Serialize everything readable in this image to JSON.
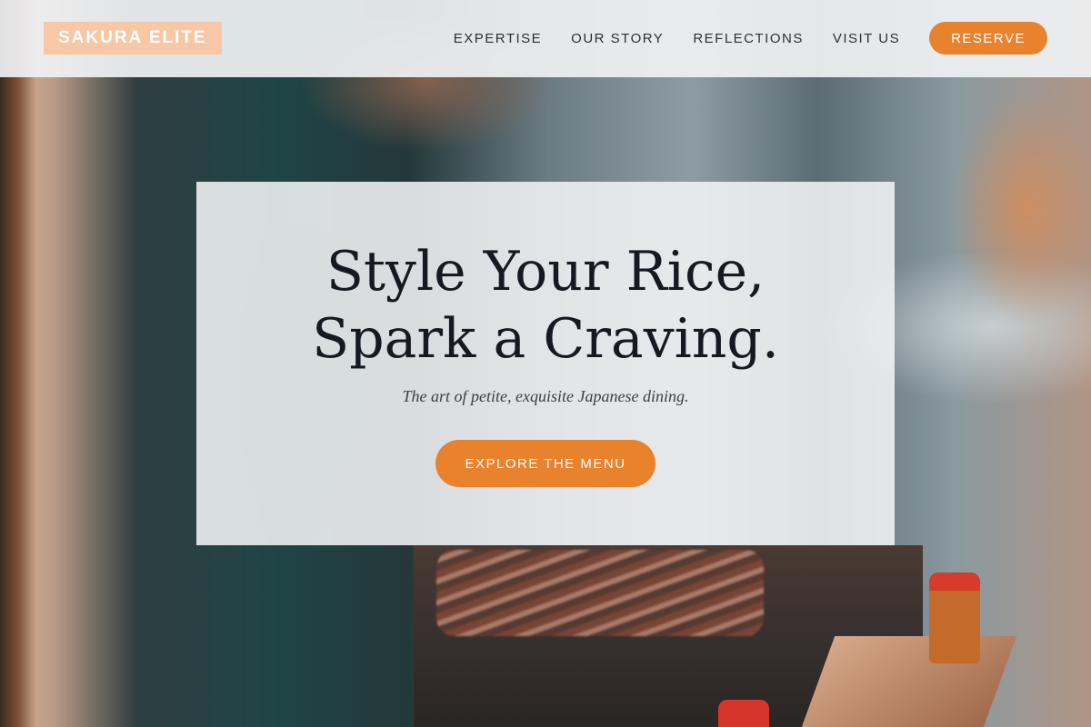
{
  "brand": {
    "logo_text": "SAKURA ELITE"
  },
  "nav": {
    "items": [
      {
        "label": "EXPERTISE"
      },
      {
        "label": "OUR STORY"
      },
      {
        "label": "REFLECTIONS"
      },
      {
        "label": "VISIT US"
      }
    ],
    "cta_label": "RESERVE"
  },
  "hero": {
    "title": "Style Your Rice, Spark a Craving.",
    "subtitle": "The art of petite, exquisite Japanese dining.",
    "cta_label": "EXPLORE THE MENU"
  },
  "colors": {
    "accent": "#e8822c",
    "logo_bg": "#f7c7a6",
    "text_dark": "#151922"
  }
}
